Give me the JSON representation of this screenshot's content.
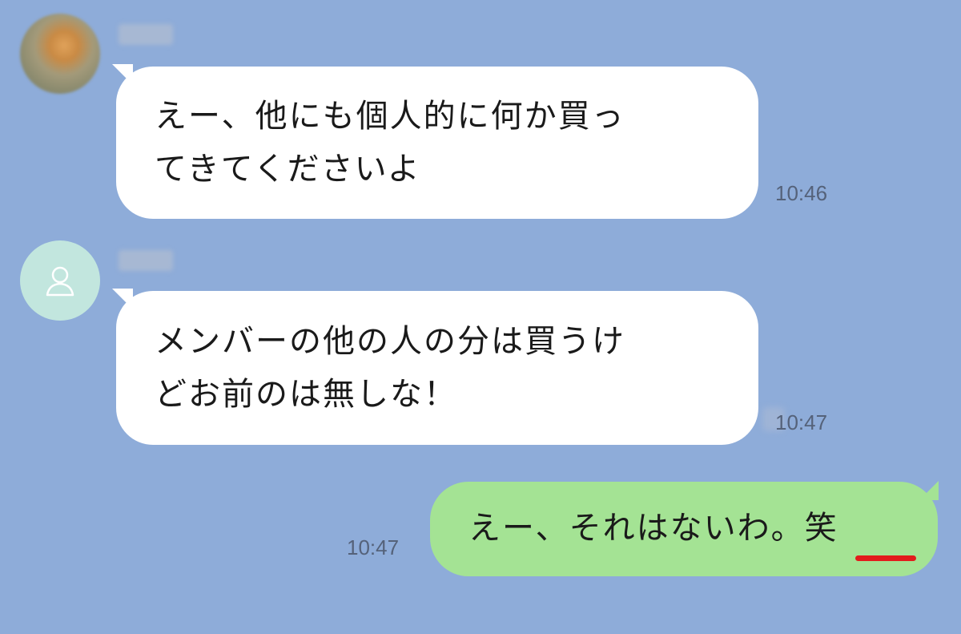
{
  "messages": [
    {
      "direction": "incoming",
      "avatar": "photo-avatar-blurred",
      "lines": [
        "えー、他にも個人的に何か買っ",
        "てきてくださいよ"
      ],
      "time": "10:46"
    },
    {
      "direction": "incoming",
      "avatar": "default-person-icon",
      "lines": [
        "メンバーの他の人の分は買うけ",
        "どお前のは無しな！"
      ],
      "time": "10:47"
    },
    {
      "direction": "outgoing",
      "text": "えー、それはないわ。",
      "emphasis": "笑",
      "time": "10:47"
    }
  ],
  "colors": {
    "background": "#8eacd9",
    "incoming_bubble": "#ffffff",
    "outgoing_bubble": "#a4e394",
    "highlight_underline": "#e21c1c",
    "default_avatar": "#c2e6de"
  }
}
